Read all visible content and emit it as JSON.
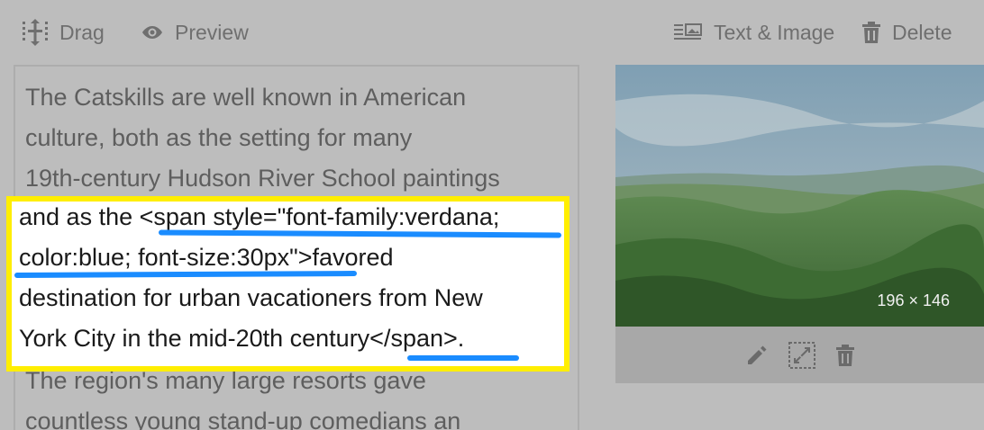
{
  "toolbar": {
    "drag_label": "Drag",
    "preview_label": "Preview",
    "text_image_label": "Text & Image",
    "delete_label": "Delete"
  },
  "editor": {
    "lines_before": [
      "The Catskills are well known in American",
      "culture, both as the setting for many",
      "19th-century Hudson River School paintings"
    ],
    "highlighted_lines": [
      "and as the <span style=\"font-family:verdana;",
      "color:blue; font-size:30px\">favored",
      "destination for urban vacationers from New",
      "York City in the mid-20th century</span>."
    ],
    "lines_after": [
      "The region's many large resorts gave",
      "countless young stand-up comedians an"
    ]
  },
  "image": {
    "caption": "196 × 146",
    "alt": "Catskills landscape"
  },
  "colors": {
    "highlight_border": "#ffee00",
    "underline": "#1a8cff"
  }
}
